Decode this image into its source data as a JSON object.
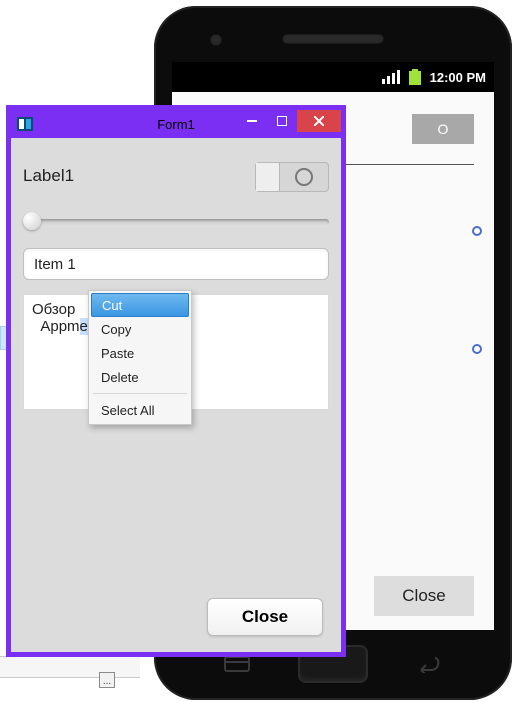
{
  "phone": {
    "status_time": "12:00 PM",
    "toggle_label": "O",
    "close_label": "Close"
  },
  "form": {
    "title": "Form1",
    "label1": "Label1",
    "combo_value": "Item 1",
    "memo_line1": "Обзор",
    "memo_line2_pre": "Appm",
    "memo_line2_sel": "ethod",
    "close_label": "Close"
  },
  "contextmenu": {
    "items": [
      "Cut",
      "Copy",
      "Paste",
      "Delete"
    ],
    "select_all": "Select All",
    "selected_index": 0
  },
  "mini_btn": "..."
}
